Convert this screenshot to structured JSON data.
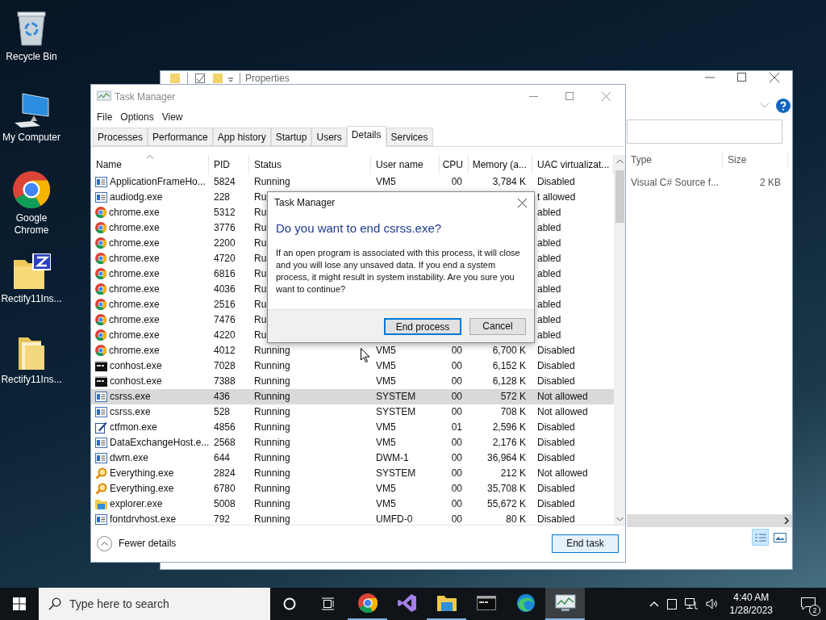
{
  "desktop_icons": [
    {
      "label": "Recycle Bin",
      "kind": "recycle"
    },
    {
      "label": "My Computer",
      "kind": "computer"
    },
    {
      "label": "Google Chrome",
      "kind": "chrome"
    },
    {
      "label": "Rectify11Ins...",
      "kind": "zip"
    },
    {
      "label": "Rectify11Ins...",
      "kind": "folder"
    }
  ],
  "explorer": {
    "title": "Properties",
    "columns": [
      "Type",
      "Size"
    ],
    "rows": [
      {
        "type": "Visual C# Source f...",
        "size": "2 KB"
      }
    ]
  },
  "task_manager": {
    "title": "Task Manager",
    "menu": [
      "File",
      "Options",
      "View"
    ],
    "tabs": [
      {
        "label": "Processes",
        "selected": false
      },
      {
        "label": "Performance",
        "selected": false
      },
      {
        "label": "App history",
        "selected": false
      },
      {
        "label": "Startup",
        "selected": false
      },
      {
        "label": "Users",
        "selected": false
      },
      {
        "label": "Details",
        "selected": true
      },
      {
        "label": "Services",
        "selected": false
      }
    ],
    "columns": [
      {
        "label": "Name",
        "sorted": true
      },
      {
        "label": "PID",
        "sorted": false
      },
      {
        "label": "Status",
        "sorted": false
      },
      {
        "label": "User name",
        "sorted": false
      },
      {
        "label": "CPU",
        "sorted": false
      },
      {
        "label": "Memory (a...",
        "sorted": false
      },
      {
        "label": "UAC virtualizat...",
        "sorted": false
      }
    ],
    "rows": [
      {
        "kind": "app",
        "name": "ApplicationFrameHo...",
        "pid": "5824",
        "status": "Running",
        "user": "VM5",
        "cpu": "00",
        "memory": "3,784 K",
        "uac": "Disabled",
        "selected": false
      },
      {
        "kind": "app",
        "name": "audiodg.exe",
        "pid": "228",
        "status": "Ru",
        "uac": "t allowed",
        "selected": false
      },
      {
        "kind": "chrome",
        "name": "chrome.exe",
        "pid": "5312",
        "status": "Ru",
        "uac": "abled",
        "selected": false
      },
      {
        "kind": "chrome",
        "name": "chrome.exe",
        "pid": "3776",
        "status": "Ru",
        "uac": "abled",
        "selected": false
      },
      {
        "kind": "chrome",
        "name": "chrome.exe",
        "pid": "2200",
        "status": "Ru",
        "uac": "abled",
        "selected": false
      },
      {
        "kind": "chrome",
        "name": "chrome.exe",
        "pid": "4720",
        "status": "Ru",
        "uac": "abled",
        "selected": false
      },
      {
        "kind": "chrome",
        "name": "chrome.exe",
        "pid": "6816",
        "status": "Ru",
        "uac": "abled",
        "selected": false
      },
      {
        "kind": "chrome",
        "name": "chrome.exe",
        "pid": "4036",
        "status": "Ru",
        "uac": "abled",
        "selected": false
      },
      {
        "kind": "chrome",
        "name": "chrome.exe",
        "pid": "2516",
        "status": "Ru",
        "uac": "abled",
        "selected": false
      },
      {
        "kind": "chrome",
        "name": "chrome.exe",
        "pid": "7476",
        "status": "Ru",
        "uac": "abled",
        "selected": false
      },
      {
        "kind": "chrome",
        "name": "chrome.exe",
        "pid": "4220",
        "status": "Ru",
        "uac": "abled",
        "selected": false
      },
      {
        "kind": "chrome",
        "name": "chrome.exe",
        "pid": "4012",
        "status": "Running",
        "user": "VM5",
        "cpu": "00",
        "memory": "6,700 K",
        "uac": "Disabled",
        "selected": false
      },
      {
        "kind": "console",
        "name": "conhost.exe",
        "pid": "7028",
        "status": "Running",
        "user": "VM5",
        "cpu": "00",
        "memory": "6,152 K",
        "uac": "Disabled",
        "selected": false
      },
      {
        "kind": "console",
        "name": "conhost.exe",
        "pid": "7388",
        "status": "Running",
        "user": "VM5",
        "cpu": "00",
        "memory": "6,128 K",
        "uac": "Disabled",
        "selected": false
      },
      {
        "kind": "app",
        "name": "csrss.exe",
        "pid": "436",
        "status": "Running",
        "user": "SYSTEM",
        "cpu": "00",
        "memory": "572 K",
        "uac": "Not allowed",
        "selected": true
      },
      {
        "kind": "app",
        "name": "csrss.exe",
        "pid": "528",
        "status": "Running",
        "user": "SYSTEM",
        "cpu": "00",
        "memory": "708 K",
        "uac": "Not allowed",
        "selected": false
      },
      {
        "kind": "pen",
        "name": "ctfmon.exe",
        "pid": "4856",
        "status": "Running",
        "user": "VM5",
        "cpu": "01",
        "memory": "2,596 K",
        "uac": "Disabled",
        "selected": false
      },
      {
        "kind": "app",
        "name": "DataExchangeHost.e...",
        "pid": "2568",
        "status": "Running",
        "user": "VM5",
        "cpu": "00",
        "memory": "2,176 K",
        "uac": "Disabled",
        "selected": false
      },
      {
        "kind": "app",
        "name": "dwm.exe",
        "pid": "644",
        "status": "Running",
        "user": "DWM-1",
        "cpu": "00",
        "memory": "36,964 K",
        "uac": "Disabled",
        "selected": false
      },
      {
        "kind": "magnifier",
        "name": "Everything.exe",
        "pid": "2824",
        "status": "Running",
        "user": "SYSTEM",
        "cpu": "00",
        "memory": "212 K",
        "uac": "Not allowed",
        "selected": false
      },
      {
        "kind": "magnifier",
        "name": "Everything.exe",
        "pid": "6780",
        "status": "Running",
        "user": "VM5",
        "cpu": "00",
        "memory": "35,708 K",
        "uac": "Disabled",
        "selected": false
      },
      {
        "kind": "folder",
        "name": "explorer.exe",
        "pid": "5008",
        "status": "Running",
        "user": "VM5",
        "cpu": "00",
        "memory": "55,672 K",
        "uac": "Disabled",
        "selected": false
      },
      {
        "kind": "app",
        "name": "fontdrvhost.exe",
        "pid": "792",
        "status": "Running",
        "user": "UMFD-0",
        "cpu": "00",
        "memory": "80 K",
        "uac": "Disabled",
        "selected": false
      }
    ],
    "footer": {
      "toggle": "Fewer details",
      "button": "End task"
    }
  },
  "dialog": {
    "title": "Task Manager",
    "heading": "Do you want to end csrss.exe?",
    "message": "If an open program is associated with this process, it will close and you will lose any unsaved data. If you end a system process, it might result in system instability. Are you sure you want to continue?",
    "buttons": [
      {
        "label": "End process",
        "default": true
      },
      {
        "label": "Cancel",
        "default": false
      }
    ]
  },
  "taskbar": {
    "search_placeholder": "Type here to search",
    "apps": [
      {
        "kind": "chrome",
        "running": true,
        "active": false
      },
      {
        "kind": "studio",
        "running": false,
        "active": false
      },
      {
        "kind": "folder",
        "running": true,
        "active": false
      },
      {
        "kind": "terminal",
        "running": false,
        "active": false
      },
      {
        "kind": "edge",
        "running": false,
        "active": false
      },
      {
        "kind": "monitor",
        "running": true,
        "active": true
      }
    ],
    "time": "4:40 AM",
    "date": "1/28/2023",
    "notifications": "2"
  }
}
